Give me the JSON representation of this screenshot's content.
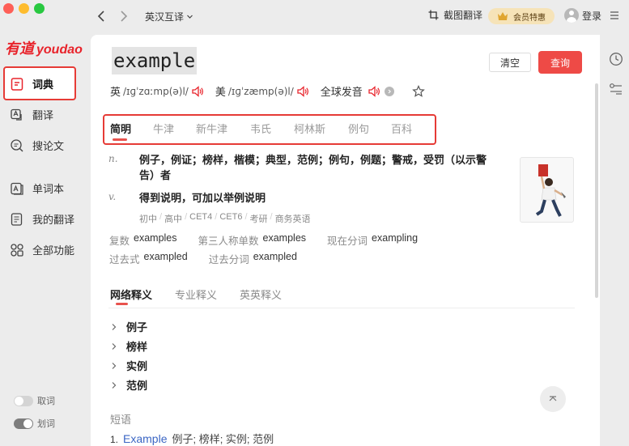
{
  "titlebar": {
    "mode_label": "英汉互译",
    "screenshot_translate_label": "截图翻译",
    "vip_label": "会员特惠",
    "login_label": "登录"
  },
  "sidebar": {
    "logo_cn": "有道",
    "logo_en": "youdao",
    "items": [
      {
        "label": "词典",
        "icon": "dictionary-icon"
      },
      {
        "label": "翻译",
        "icon": "translate-icon"
      },
      {
        "label": "搜论文",
        "icon": "paper-search-icon"
      },
      {
        "label": "单词本",
        "icon": "wordbook-icon"
      },
      {
        "label": "我的翻译",
        "icon": "my-translation-icon"
      },
      {
        "label": "全部功能",
        "icon": "all-features-icon"
      }
    ],
    "toggles": [
      {
        "label": "取词",
        "on": false
      },
      {
        "label": "划词",
        "on": true
      }
    ]
  },
  "search": {
    "word": "example",
    "clear_label": "清空",
    "query_label": "查询"
  },
  "phonetics": {
    "uk_label": "英",
    "uk_ipa": "/ɪɡˈzɑːmp(ə)l/",
    "us_label": "美",
    "us_ipa": "/ɪɡˈzæmp(ə)l/",
    "global_label": "全球发音"
  },
  "dict_tabs": [
    "简明",
    "牛津",
    "新牛津",
    "韦氏",
    "柯林斯",
    "例句",
    "百科"
  ],
  "definitions": [
    {
      "pos": "n.",
      "meaning": "例子，例证；榜样，楷模；典型，范例；例句，例题；警戒，受罚（以示警告）者"
    },
    {
      "pos": "v.",
      "meaning": "得到说明，可加以举例说明"
    }
  ],
  "tags": [
    "初中",
    "高中",
    "CET4",
    "CET6",
    "考研",
    "商务英语"
  ],
  "forms": {
    "row1": [
      {
        "label": "复数",
        "value": "examples"
      },
      {
        "label": "第三人称单数",
        "value": "examples"
      },
      {
        "label": "现在分词",
        "value": "exampling"
      }
    ],
    "row2": [
      {
        "label": "过去式",
        "value": "exampled"
      },
      {
        "label": "过去分词",
        "value": "exampled"
      }
    ]
  },
  "web_tabs": [
    "网络释义",
    "专业释义",
    "英英释义"
  ],
  "web_items": [
    "例子",
    "榜样",
    "实例",
    "范例"
  ],
  "phrases": {
    "title": "短语",
    "items": [
      {
        "num": "1.",
        "term": "Example",
        "meaning": "例子; 榜样; 实例; 范例"
      }
    ]
  },
  "colors": {
    "brand_red": "#e8232b",
    "query_button": "#ee4a46",
    "link_blue": "#3b66c4",
    "highlight_box": "#e63b36"
  }
}
